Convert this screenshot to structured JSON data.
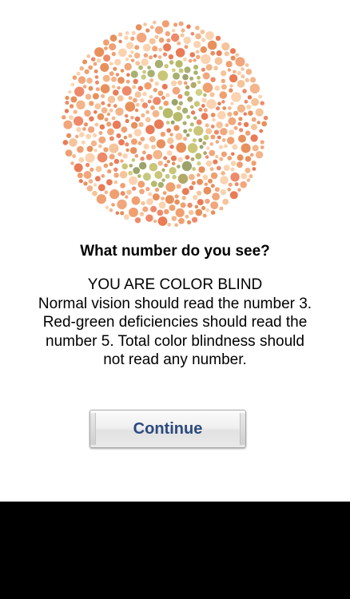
{
  "plate": {
    "colors": {
      "background_dots": [
        "#f0a070",
        "#e8905c",
        "#f3b58a",
        "#ee8a6a",
        "#f6c49a",
        "#e97b57",
        "#f2a67c",
        "#fbd3b0"
      ],
      "figure_dots": [
        "#c9c678",
        "#b6bb6b",
        "#a8b070",
        "#d2cf86",
        "#9aa36a",
        "#c4c97f",
        "#b2a868"
      ]
    }
  },
  "question": "What number do you see?",
  "result_lines": [
    "YOU ARE COLOR BLIND",
    "Normal vision should read the number 3.",
    "Red-green deficiencies should read the",
    "number 5.  Total color blindness should",
    "not read any number."
  ],
  "continue_label": "Continue"
}
